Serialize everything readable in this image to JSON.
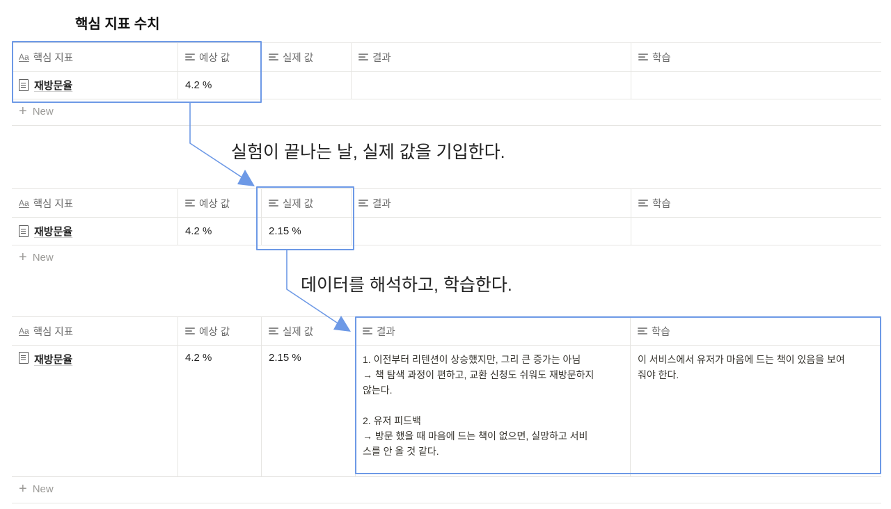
{
  "page_title": "핵심 지표 수치",
  "columns": {
    "metric": "핵심 지표",
    "expected": "예상 값",
    "actual": "실제 값",
    "result": "결과",
    "learning": "학습"
  },
  "row_name": "재방문율",
  "expected_value": "4.2 %",
  "actual_value": "2.15 %",
  "new_label": "New",
  "annotation_1": "실험이 끝나는 날, 실제 값을 기입한다.",
  "annotation_2": "데이터를 해석하고, 학습한다.",
  "result_lines": [
    "1. 이전부터 리텐션이 상승했지만, 그리 큰 증가는 아님",
    "→ 책 탐색 과정이 편하고, 교환 신청도 쉬워도 재방문하지",
    "않는다.",
    "",
    "2. 유저 피드백",
    "→ 방문 했을 때 마음에 드는 책이 없으면, 실망하고 서비",
    "스를 안 올 것 같다."
  ],
  "learning_lines": [
    "이 서비스에서 유저가 마음에 드는 책이 있음을 보여",
    "줘야 한다."
  ],
  "highlight_color": "#6d99e6",
  "icons": {
    "title_column": "aa-text-icon",
    "text_column": "text-lines-icon",
    "row_page": "page-doc-icon",
    "new_row": "plus-icon"
  }
}
